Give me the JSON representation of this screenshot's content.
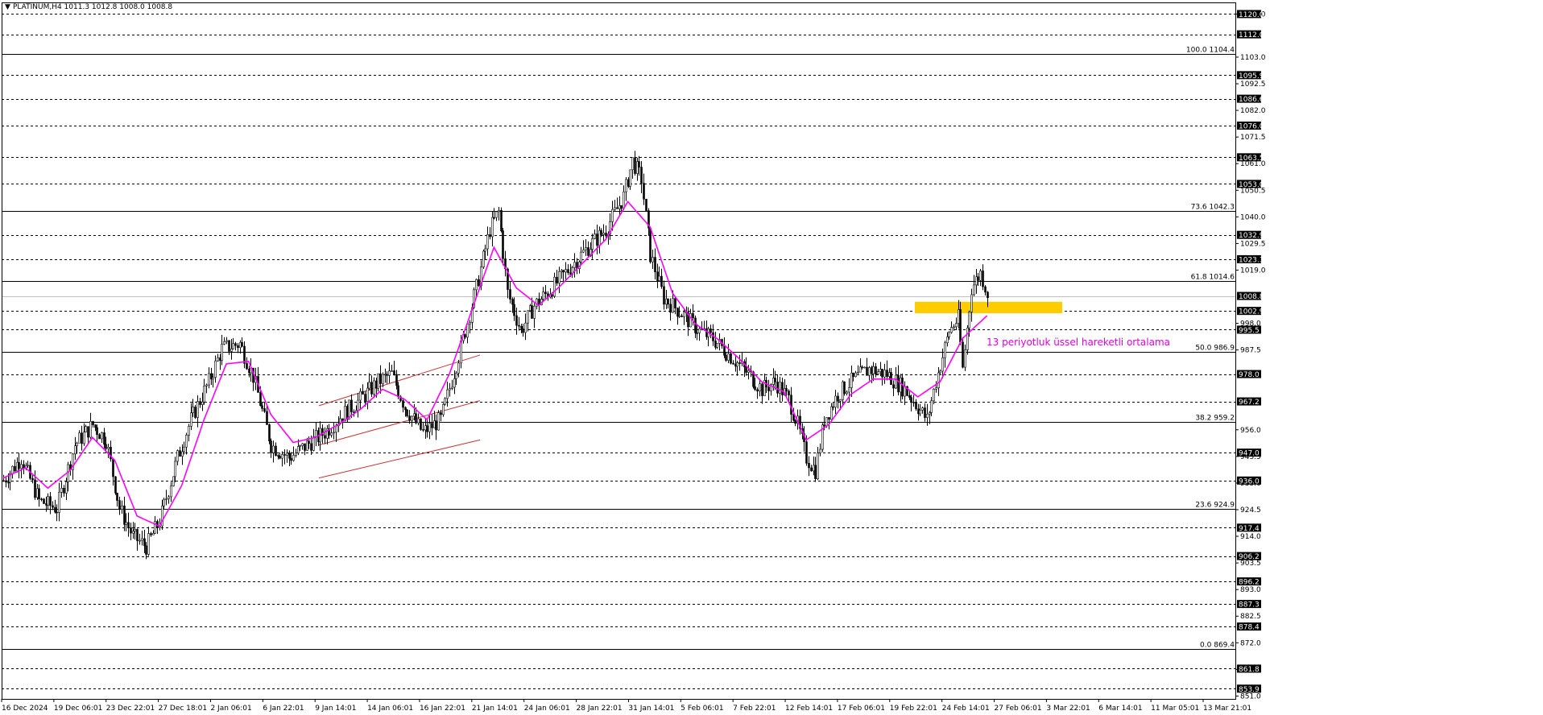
{
  "symbol_header": "PLATINUM,H4  1011.3 1012.8 1008.0 1008.8",
  "symbol_marker": "▼",
  "colors": {
    "background": "#ffffff",
    "frame": "#000000",
    "grid_dashed": "#000000",
    "candles": "#000000",
    "ema": "#ff00ff",
    "channel": "#cc3333",
    "zone": "#ffcc00",
    "annotation": "#e000e0",
    "price_tag_bg": "#000000",
    "price_tag_text": "#ffffff",
    "current_line": "#c0c0c0"
  },
  "chart_data": {
    "type": "candlestick",
    "timeframe": "H4",
    "ylim": [
      850.5,
      1123.0
    ],
    "current_price": 1008.8,
    "x_tick_labels": [
      "16 Dec 2024",
      "19 Dec 06:01",
      "23 Dec 22:01",
      "27 Dec 18:01",
      "2 Jan 06:01",
      "6 Jan 22:01",
      "9 Jan 14:01",
      "14 Jan 06:01",
      "16 Jan 22:01",
      "21 Jan 14:01",
      "24 Jan 06:01",
      "28 Jan 22:01",
      "31 Jan 14:01",
      "5 Feb 06:01",
      "7 Feb 22:01",
      "12 Feb 14:01",
      "17 Feb 06:01",
      "19 Feb 22:01",
      "24 Feb 14:01",
      "27 Feb 06:01",
      "3 Mar 22:01",
      "6 Mar 14:01",
      "11 Mar 05:01",
      "13 Mar 21:01"
    ],
    "y_tick_labels": [
      "1120.0",
      "1103.0",
      "1092.5",
      "1082.0",
      "1071.5",
      "1061.0",
      "1050.5",
      "1040.0",
      "1029.5",
      "1019.0",
      "998.0",
      "987.5",
      "956.0",
      "945.5",
      "935.0",
      "924.5",
      "914.0",
      "903.5",
      "893.0",
      "882.5",
      "872.0",
      "861.5",
      "851.0"
    ],
    "horizontal_levels": [
      1120.0,
      1112.0,
      1095.9,
      1086.6,
      1076.0,
      1063.5,
      1053.0,
      1032.9,
      1023.3,
      1008.8,
      1002.9,
      995.5,
      978.0,
      967.2,
      947.0,
      936.0,
      917.4,
      906.2,
      896.2,
      887.3,
      878.4,
      861.8,
      853.9
    ],
    "price_tags": [
      "1120.0",
      "1112.0",
      "1095.9",
      "1086.6",
      "1076.0",
      "1063.5",
      "1053.0",
      "1032.9",
      "1023.3",
      "1008.8",
      "1002.9",
      "995.5",
      "978.0",
      "967.2",
      "947.0",
      "936.0",
      "917.4",
      "906.2",
      "896.2",
      "887.3",
      "878.4",
      "861.8",
      "853.9"
    ],
    "fibonacci": [
      {
        "label": "100.0 1104.4",
        "price": 1104.4
      },
      {
        "label": "73.6 1042.3",
        "price": 1042.3
      },
      {
        "label": "61.8 1014.6",
        "price": 1014.6
      },
      {
        "label": "50.0 986.9",
        "price": 986.9
      },
      {
        "label": "38.2 959.2",
        "price": 959.2
      },
      {
        "label": "23.6 924.9",
        "price": 924.9
      },
      {
        "label": "0.0 869.4",
        "price": 869.4
      }
    ],
    "highlight_zone": {
      "from": 1002.0,
      "to": 1006.5
    },
    "ema_label": "13 periyotluk üssel hareketli ortalama",
    "swing_path": [
      [
        0,
        936
      ],
      [
        8,
        945
      ],
      [
        16,
        928
      ],
      [
        24,
        925
      ],
      [
        32,
        950
      ],
      [
        40,
        958
      ],
      [
        46,
        952
      ],
      [
        52,
        925
      ],
      [
        58,
        914
      ],
      [
        64,
        910
      ],
      [
        70,
        920
      ],
      [
        78,
        945
      ],
      [
        84,
        960
      ],
      [
        92,
        975
      ],
      [
        98,
        988
      ],
      [
        106,
        990
      ],
      [
        112,
        977
      ],
      [
        120,
        950
      ],
      [
        128,
        945
      ],
      [
        136,
        950
      ],
      [
        144,
        955
      ],
      [
        152,
        962
      ],
      [
        160,
        968
      ],
      [
        168,
        975
      ],
      [
        174,
        978
      ],
      [
        180,
        965
      ],
      [
        188,
        955
      ],
      [
        196,
        960
      ],
      [
        204,
        985
      ],
      [
        212,
        1012
      ],
      [
        218,
        1035
      ],
      [
        222,
        1042
      ],
      [
        226,
        1010
      ],
      [
        232,
        995
      ],
      [
        238,
        1005
      ],
      [
        246,
        1012
      ],
      [
        254,
        1020
      ],
      [
        262,
        1028
      ],
      [
        270,
        1035
      ],
      [
        278,
        1048
      ],
      [
        282,
        1062
      ],
      [
        286,
        1055
      ],
      [
        290,
        1025
      ],
      [
        296,
        1008
      ],
      [
        304,
        1002
      ],
      [
        312,
        995
      ],
      [
        318,
        992
      ],
      [
        326,
        985
      ],
      [
        334,
        978
      ],
      [
        340,
        972
      ],
      [
        346,
        975
      ],
      [
        352,
        968
      ],
      [
        356,
        958
      ],
      [
        360,
        945
      ],
      [
        364,
        940
      ],
      [
        368,
        960
      ],
      [
        374,
        970
      ],
      [
        380,
        975
      ],
      [
        388,
        980
      ],
      [
        396,
        978
      ],
      [
        404,
        972
      ],
      [
        410,
        965
      ],
      [
        414,
        960
      ],
      [
        418,
        975
      ],
      [
        424,
        995
      ],
      [
        428,
        1000
      ],
      [
        430,
        980
      ],
      [
        434,
        1012
      ],
      [
        438,
        1018
      ],
      [
        441,
        1010
      ]
    ],
    "ema_samples": [
      [
        0,
        937
      ],
      [
        10,
        941
      ],
      [
        20,
        933
      ],
      [
        30,
        940
      ],
      [
        40,
        953
      ],
      [
        50,
        944
      ],
      [
        60,
        922
      ],
      [
        70,
        918
      ],
      [
        80,
        934
      ],
      [
        90,
        960
      ],
      [
        100,
        982
      ],
      [
        110,
        983
      ],
      [
        120,
        962
      ],
      [
        130,
        951
      ],
      [
        140,
        953
      ],
      [
        150,
        958
      ],
      [
        160,
        964
      ],
      [
        170,
        972
      ],
      [
        180,
        968
      ],
      [
        190,
        960
      ],
      [
        200,
        978
      ],
      [
        210,
        1003
      ],
      [
        220,
        1028
      ],
      [
        230,
        1012
      ],
      [
        240,
        1005
      ],
      [
        250,
        1013
      ],
      [
        260,
        1022
      ],
      [
        270,
        1031
      ],
      [
        280,
        1046
      ],
      [
        290,
        1036
      ],
      [
        300,
        1010
      ],
      [
        310,
        998
      ],
      [
        320,
        992
      ],
      [
        330,
        984
      ],
      [
        340,
        975
      ],
      [
        350,
        971
      ],
      [
        360,
        952
      ],
      [
        370,
        958
      ],
      [
        380,
        970
      ],
      [
        390,
        976
      ],
      [
        400,
        976
      ],
      [
        410,
        969
      ],
      [
        420,
        975
      ],
      [
        430,
        992
      ],
      [
        441,
        1001
      ]
    ],
    "candle_count": 442,
    "channel_lines": [
      {
        "from": [
          112,
          965.5
        ],
        "to": [
          170,
          985.5
        ]
      },
      {
        "from": [
          112,
          950.0
        ],
        "to": [
          170,
          967.5
        ]
      },
      {
        "from": [
          112,
          937.0
        ],
        "to": [
          170,
          952.0
        ]
      }
    ]
  }
}
